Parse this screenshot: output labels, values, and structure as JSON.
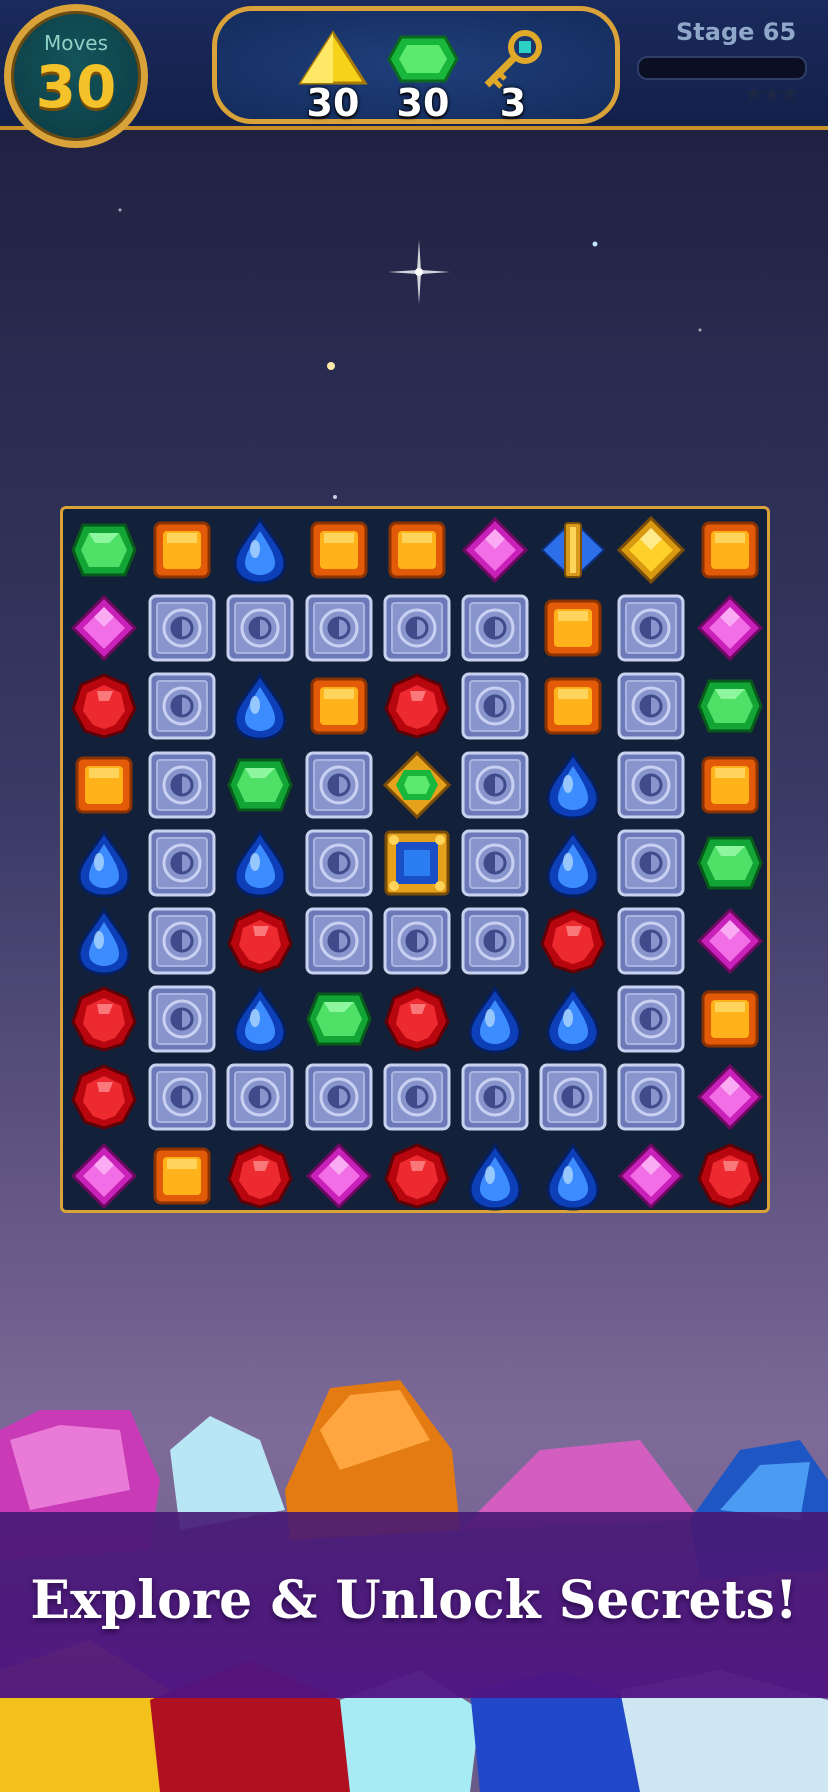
{
  "hud": {
    "moves_label": "Moves",
    "moves_value": "30",
    "goals": [
      {
        "icon": "yellow-triangle-gem-icon",
        "count": "30"
      },
      {
        "icon": "green-gem-icon",
        "count": "30"
      },
      {
        "icon": "golden-key-icon",
        "count": "3"
      }
    ],
    "stage_label": "Stage 65",
    "stage_progress": 0,
    "stars_earned": 0,
    "stars_total": 3
  },
  "board": {
    "rows": 9,
    "cols": 9,
    "cells": [
      [
        "green",
        "orange",
        "blue",
        "orange",
        "orange",
        "pink",
        "blue-hourglass",
        "gold-diamond",
        "orange"
      ],
      [
        "pink",
        "stone",
        "stone",
        "stone",
        "stone",
        "stone",
        "orange",
        "stone",
        "pink"
      ],
      [
        "red",
        "stone",
        "blue",
        "orange",
        "red",
        "stone",
        "orange",
        "stone",
        "green"
      ],
      [
        "orange",
        "stone",
        "green",
        "stone",
        "gold-green",
        "stone",
        "blue",
        "stone",
        "orange"
      ],
      [
        "blue",
        "stone",
        "blue",
        "stone",
        "gold-blue",
        "stone",
        "blue",
        "stone",
        "green"
      ],
      [
        "blue",
        "stone",
        "red",
        "stone",
        "stone",
        "stone",
        "red",
        "stone",
        "pink"
      ],
      [
        "red",
        "stone",
        "blue",
        "green",
        "red",
        "blue",
        "blue",
        "stone",
        "orange"
      ],
      [
        "red",
        "stone",
        "stone",
        "stone",
        "stone",
        "stone",
        "stone",
        "stone",
        "pink"
      ],
      [
        "pink",
        "orange",
        "red",
        "pink",
        "red",
        "blue",
        "blue",
        "pink",
        "red"
      ]
    ]
  },
  "banner": {
    "text": "Explore & Unlock Secrets!"
  },
  "colors": {
    "hud_gold": "#d9a33a",
    "moves_number": "#f4c22a",
    "banner_purple": "#4b1a7a"
  }
}
